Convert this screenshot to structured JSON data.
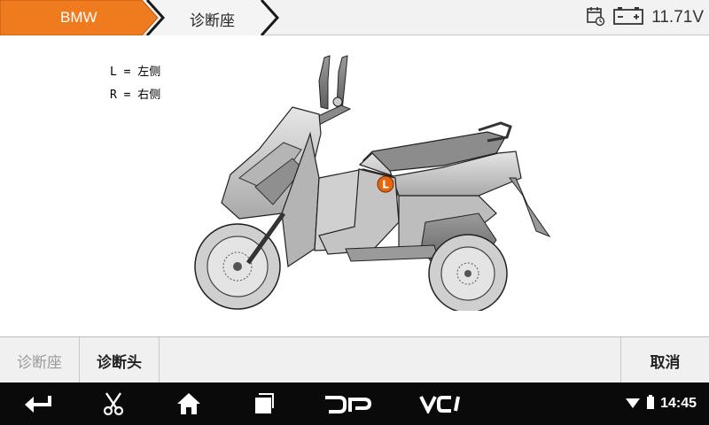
{
  "breadcrumb": {
    "items": [
      {
        "label": "BMW",
        "active": true
      },
      {
        "label": "诊断座",
        "active": false
      }
    ]
  },
  "status": {
    "voltage": "11.71V",
    "calendar_icon": "calendar-clock-icon",
    "battery_icon": "car-battery-icon"
  },
  "legend": {
    "lines": [
      "L = 左侧",
      "R = 右侧"
    ]
  },
  "figure": {
    "marker_label": "L"
  },
  "actions": {
    "diag_seat": "诊断座",
    "diag_head": "诊断头",
    "cancel": "取消"
  },
  "system_nav": {
    "clock": "14:45",
    "icons": [
      "back-icon",
      "scissors-icon",
      "home-icon",
      "recent-apps-icon",
      "dp-logo-icon",
      "vci-logo-icon",
      "wifi-icon",
      "battery-icon"
    ]
  },
  "colors": {
    "accent": "#f07a1e",
    "marker": "#e8650f",
    "navbar": "#0a0a0a"
  }
}
